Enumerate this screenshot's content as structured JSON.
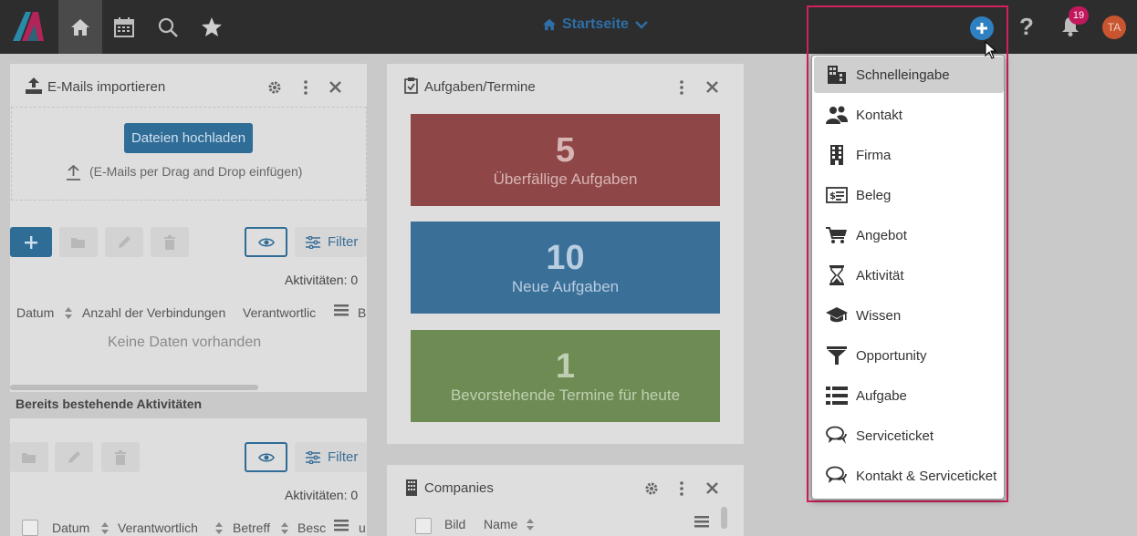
{
  "topbar": {
    "title": "Startseite",
    "user_initials": "TA",
    "notification_count": "19",
    "help_label": "?"
  },
  "email_import": {
    "title": "E-Mails importieren",
    "upload_button": "Dateien hochladen",
    "drop_hint": "(E-Mails per Drag and Drop einfügen)",
    "filter_label": "Filter",
    "activities_count": "Aktivitäten: 0",
    "columns": [
      "Datum",
      "Anzahl der Verbindungen",
      "Verantwortlic",
      "B"
    ],
    "empty_text": "Keine Daten vorhanden"
  },
  "existing_activities": {
    "title": "Bereits bestehende Aktivitäten",
    "filter_label": "Filter",
    "activities_count": "Aktivitäten: 0",
    "columns": [
      "Datum",
      "Verantwortlich",
      "Betreff",
      "Besc",
      "u"
    ]
  },
  "tasks": {
    "title": "Aufgaben/Termine",
    "tiles": [
      {
        "number": "5",
        "label": "Überfällige Aufgaben",
        "color": "#8e4646"
      },
      {
        "number": "10",
        "label": "Neue Aufgaben",
        "color": "#3a6f98"
      },
      {
        "number": "1",
        "label": "Bevorstehende Termine für heute",
        "color": "#6e8b53"
      }
    ]
  },
  "companies": {
    "title": "Companies",
    "columns": [
      "Bild",
      "Name"
    ]
  },
  "create_menu": {
    "items": [
      {
        "label": "Schnelleingabe",
        "icon": "quick-entry-icon"
      },
      {
        "label": "Kontakt",
        "icon": "contact-icon"
      },
      {
        "label": "Firma",
        "icon": "building-icon"
      },
      {
        "label": "Beleg",
        "icon": "receipt-icon"
      },
      {
        "label": "Angebot",
        "icon": "cart-icon"
      },
      {
        "label": "Aktivität",
        "icon": "hourglass-icon"
      },
      {
        "label": "Wissen",
        "icon": "graduation-cap-icon"
      },
      {
        "label": "Opportunity",
        "icon": "funnel-icon"
      },
      {
        "label": "Aufgabe",
        "icon": "task-list-icon"
      },
      {
        "label": "Serviceticket",
        "icon": "speech-bubbles-icon"
      },
      {
        "label": "Kontakt & Serviceticket",
        "icon": "speech-bubbles-icon"
      }
    ]
  },
  "colors": {
    "accent": "#2f80c0",
    "highlight": "#d21f5d",
    "topbar": "#2d2d2d"
  }
}
